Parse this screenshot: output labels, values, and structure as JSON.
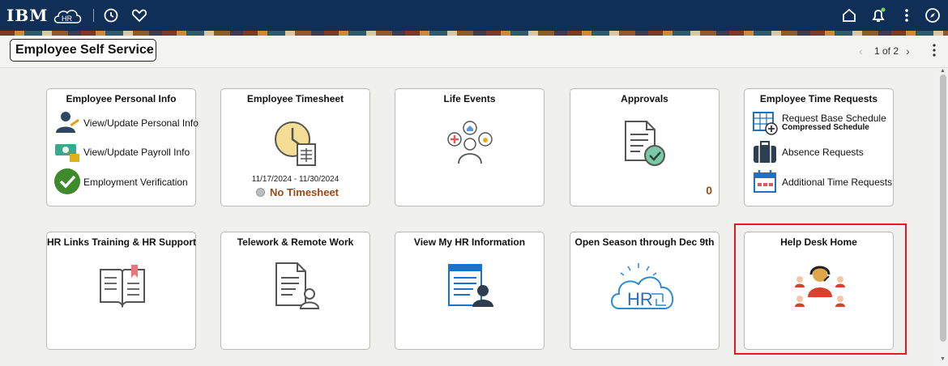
{
  "topbar": {
    "brand": "IBM",
    "icons": [
      "hr-cloud-logo",
      "history-icon",
      "favorites-icon",
      "home-icon",
      "notifications-icon",
      "actions-menu-icon",
      "navigator-icon"
    ],
    "background": "#0f2f57"
  },
  "subbar": {
    "homepage_selector": "Employee Self Service",
    "pager": "1 of 2"
  },
  "tiles": {
    "personal_info": {
      "title": "Employee Personal Info",
      "links": [
        "View/Update Personal Info",
        "View/Update Payroll Info",
        "Employment Verification"
      ]
    },
    "timesheet": {
      "title": "Employee Timesheet",
      "period": "11/17/2024 - 11/30/2024",
      "status": "No Timesheet"
    },
    "life_events": {
      "title": "Life Events"
    },
    "approvals": {
      "title": "Approvals",
      "count": "0"
    },
    "time_requests": {
      "title": "Employee Time Requests",
      "links": [
        "Request Base Schedule",
        "Absence Requests",
        "Additional Time Requests"
      ],
      "sub": "Compressed Schedule"
    },
    "training": {
      "title": "HR Links Training & HR Support"
    },
    "telework": {
      "title": "Telework & Remote Work"
    },
    "my_hr": {
      "title": "View My HR Information"
    },
    "open_season": {
      "title": "Open Season through Dec 9th",
      "logo_text": "HR"
    },
    "help_desk": {
      "title": "Help Desk Home"
    }
  },
  "colors": {
    "highlight": "#e21b1b",
    "status_text": "#9a4a16",
    "accent_blue": "#1a73c8"
  }
}
